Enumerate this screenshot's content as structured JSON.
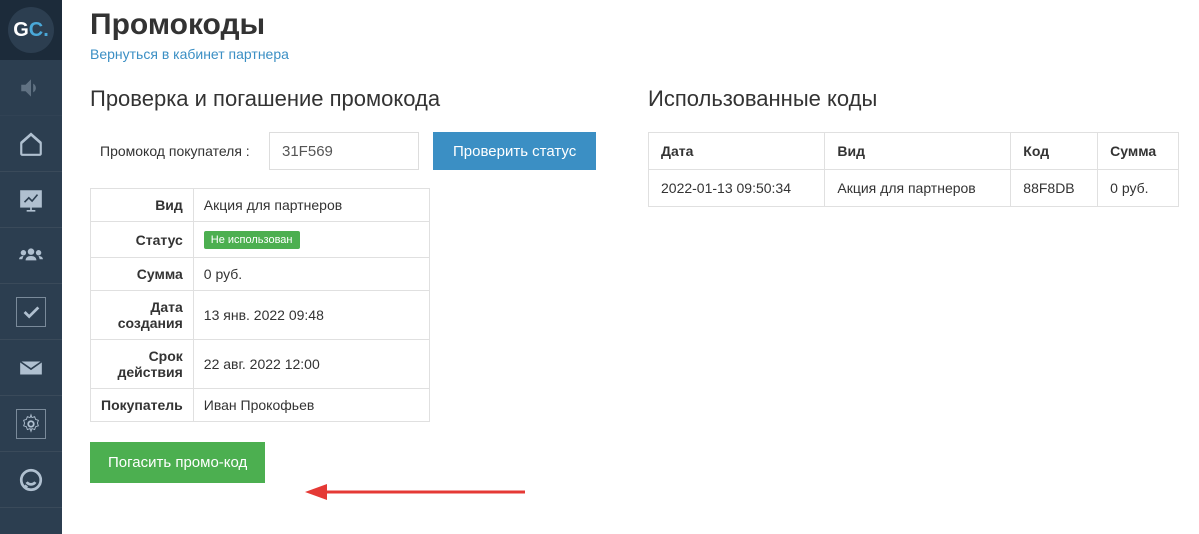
{
  "page": {
    "title": "Промокоды",
    "back_link": "Вернуться в кабинет партнера"
  },
  "check_section": {
    "heading": "Проверка и погашение промокода",
    "label": "Промокод покупателя :",
    "input_value": "31F569",
    "check_button": "Проверить статус",
    "redeem_button": "Погасить промо-код"
  },
  "details": {
    "type_label": "Вид",
    "type_value": "Акция для партнеров",
    "status_label": "Статус",
    "status_value": "Не использован",
    "sum_label": "Сумма",
    "sum_value": "0 руб.",
    "created_label": "Дата создания",
    "created_value": "13 янв. 2022 09:48",
    "expires_label": "Срок действия",
    "expires_value": "22 авг. 2022 12:00",
    "buyer_label": "Покупатель",
    "buyer_value": "Иван Прокофьев"
  },
  "used_section": {
    "heading": "Использованные коды",
    "headers": {
      "date": "Дата",
      "type": "Вид",
      "code": "Код",
      "sum": "Сумма"
    },
    "row": {
      "date": "2022-01-13 09:50:34",
      "type": "Акция для партнеров",
      "code": "88F8DB",
      "sum": "0 руб."
    }
  }
}
